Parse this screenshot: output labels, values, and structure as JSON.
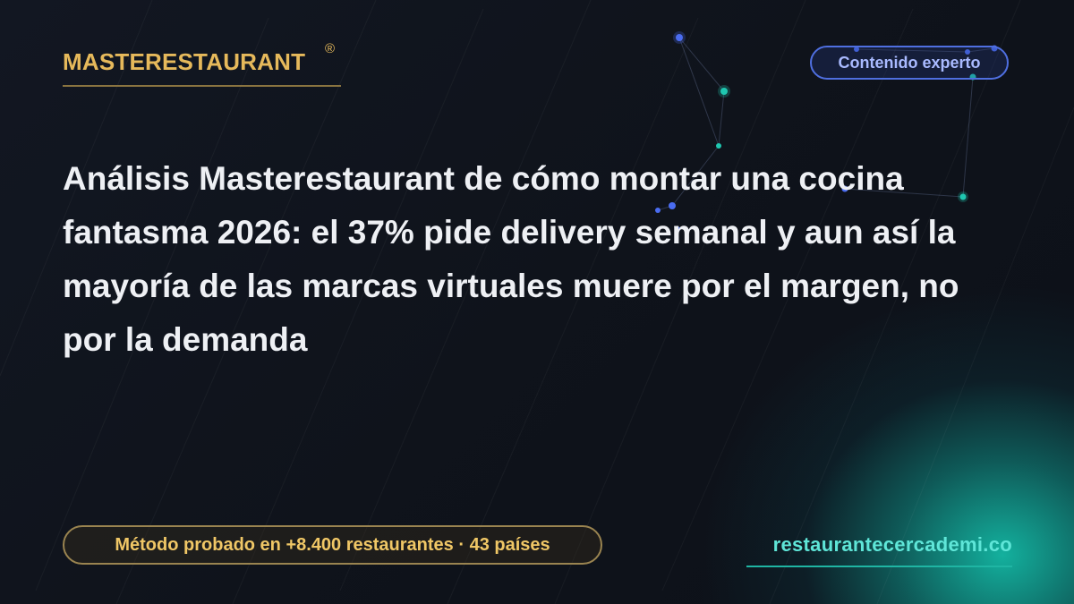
{
  "brand": {
    "name": "MASTERESTAURANT",
    "registered": "®"
  },
  "badge": {
    "label": "Contenido experto"
  },
  "headline": "Análisis Masterestaurant de cómo montar una cocina fantasma 2026: el 37% pide delivery semanal y aun así la mayoría de las marcas virtuales muere por el margen, no por la demanda",
  "footer": {
    "method": "Método probado en +8.400 restaurantes · 43 países",
    "site": "restaurantecercademi.co"
  },
  "colors": {
    "background": "#0f131b",
    "accent_gold": "#e6b95b",
    "accent_blue": "#4f6fe0",
    "accent_teal": "#1fb5a3",
    "headline": "#eef0f4"
  },
  "icons": {
    "constellation": "constellation-decoration"
  }
}
